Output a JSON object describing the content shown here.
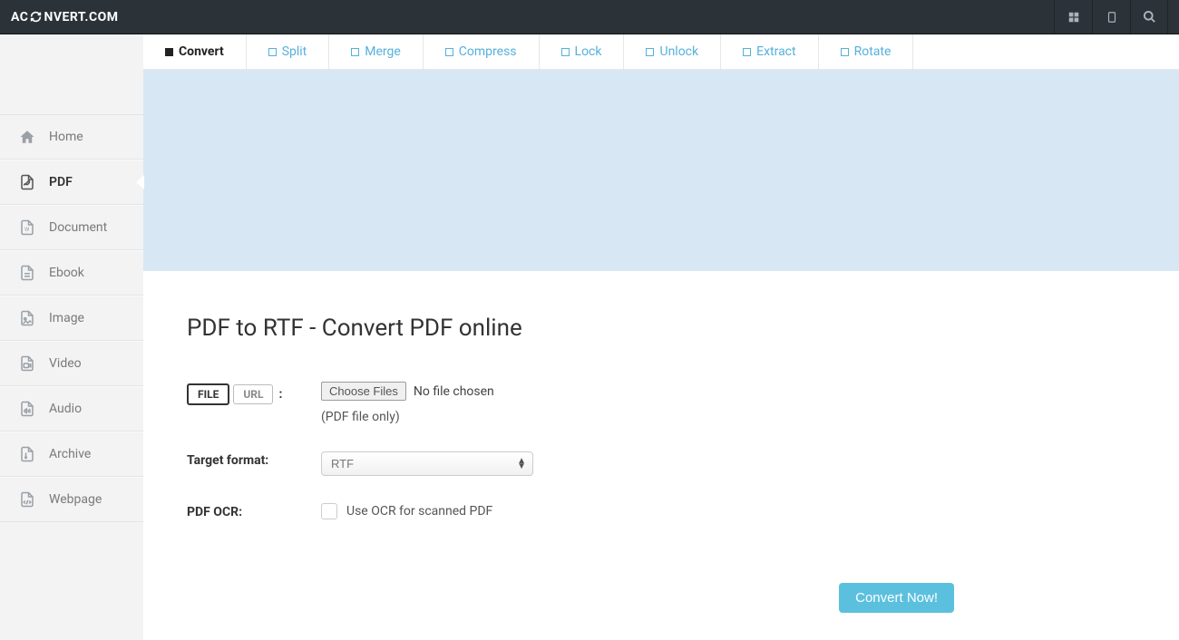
{
  "logo": {
    "left": "AC",
    "right": "NVERT.COM"
  },
  "sidebar": {
    "items": [
      {
        "label": "Home"
      },
      {
        "label": "PDF"
      },
      {
        "label": "Document"
      },
      {
        "label": "Ebook"
      },
      {
        "label": "Image"
      },
      {
        "label": "Video"
      },
      {
        "label": "Audio"
      },
      {
        "label": "Archive"
      },
      {
        "label": "Webpage"
      }
    ]
  },
  "tabs": [
    {
      "label": "Convert"
    },
    {
      "label": "Split"
    },
    {
      "label": "Merge"
    },
    {
      "label": "Compress"
    },
    {
      "label": "Lock"
    },
    {
      "label": "Unlock"
    },
    {
      "label": "Extract"
    },
    {
      "label": "Rotate"
    }
  ],
  "page": {
    "title": "PDF to RTF - Convert PDF online"
  },
  "form": {
    "source_tab_file": "FILE",
    "source_tab_url": "URL",
    "choose_files": "Choose Files",
    "no_file_chosen": "No file chosen",
    "file_hint": "(PDF file only)",
    "target_label": "Target format:",
    "target_value": "RTF",
    "ocr_label": "PDF OCR:",
    "ocr_text": "Use OCR for scanned PDF",
    "convert_button": "Convert Now!"
  }
}
